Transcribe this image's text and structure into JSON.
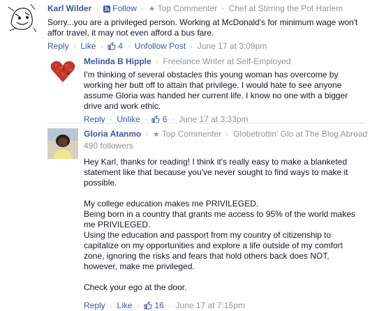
{
  "comments": [
    {
      "name": "Karl Wilder",
      "follow_label": "Follow",
      "badge": "Top Commenter",
      "role": "Chef at Stirring the Pot Harlem",
      "text": "Sorry...you are a privileged person. Working at McDonald's for minimum wage won't affor travel, it may not even afford a bus fare.",
      "actions": {
        "reply": "Reply",
        "like": "Like",
        "likes": "4",
        "extra": "Unfollow Post",
        "time": "June 17 at 3:09pm"
      }
    },
    {
      "name": "Melinda B Hipple",
      "role": "Freelance Writer at Self-Employed",
      "text": "I'm thinking of several obstacles this young woman has overcome by working her butt off to attain that privilege. I would hate to see anyone assume Gloria was handed her current life. I know no one with a bigger drive and work ethic.",
      "actions": {
        "reply": "Reply",
        "like": "Unlike",
        "likes": "6",
        "time": "June 17 at 3:33pm"
      }
    },
    {
      "name": "Gloria Atanmo",
      "badge": "Top Commenter",
      "role_prefix": "Globetrottin' Glo at",
      "role_link": "The Blog Abroad",
      "followers": "490 followers",
      "paragraphs": [
        "Hey Karl, thanks for reading! I think it's really easy to make a blanketed statement like that because you've never sought to find ways to make it possible.",
        "My college education makes me PRIVILEGED.\nBeing born in a country that grants me access to 95% of the world makes me PRIVILEGED.\nUsing the education and passport from my country of citizenship to capitalize on my opportunities and explore a life outside of my comfort zone, ignoring the risks and fears that hold others back does NOT, however, make me privileged.",
        "Check your ego at the door."
      ],
      "actions": {
        "reply": "Reply",
        "like": "Like",
        "likes": "16",
        "time": "June 17 at 7:15pm"
      }
    }
  ],
  "colors": {
    "link": "#3b5998",
    "muted": "#90949c",
    "text": "#141823"
  }
}
